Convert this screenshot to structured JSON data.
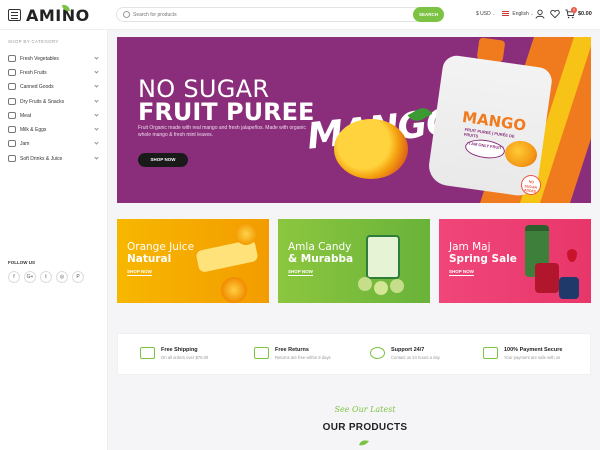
{
  "header": {
    "logo": "AMINO",
    "search_placeholder": "Search for products",
    "search_button": "SEARCH",
    "currency": "$ USD",
    "language": "English",
    "cart_total": "$0.00",
    "cart_count": "0"
  },
  "sidebar": {
    "title": "SHOP BY CATEGORY",
    "categories": [
      {
        "label": "Fresh Vegetables"
      },
      {
        "label": "Fresh Fruits"
      },
      {
        "label": "Canned Goods"
      },
      {
        "label": "Dry Fruits & Snacks"
      },
      {
        "label": "Meat"
      },
      {
        "label": "Milk & Eggs"
      },
      {
        "label": "Jam"
      },
      {
        "label": "Soft Drinks & Juice"
      }
    ],
    "follow_title": "FOLLOW US",
    "social": [
      "f",
      "G+",
      "t",
      "◎",
      "P"
    ]
  },
  "hero": {
    "line1": "NO SUGAR",
    "line2": "FRUIT PUREE",
    "description": "Fruit Organic made with real mango and fresh jalapeños. Made with organic whole mango & fresh mint leaves.",
    "button": "SHOP NOW",
    "brand_word": "MANGO",
    "pouch_label": "MANGO",
    "pouch_sub": "FRUIT PUREE | PURÉE DE FRUITS",
    "pouch_bubble": "\"I AM ONLY FRUIT\"",
    "badge": "NO SUGAR ADDED"
  },
  "promos": [
    {
      "title_light": "Orange Juice",
      "title_bold": "Natural",
      "link": "SHOP NOW",
      "color": "#f7b700"
    },
    {
      "title_light": "Amla Candy",
      "title_bold": "& Murabba",
      "link": "SHOP NOW",
      "color": "#8cc63f"
    },
    {
      "title_light": "Jam Maj",
      "title_bold": "Spring Sale",
      "link": "SHOP NOW",
      "color": "#f0467a"
    }
  ],
  "features": [
    {
      "title": "Free Shipping",
      "desc": "On all orders over $75.00"
    },
    {
      "title": "Free Returns",
      "desc": "Returns are free within 9 days"
    },
    {
      "title": "Support 24/7",
      "desc": "Contact us 24 hours a day"
    },
    {
      "title": "100% Payment Secure",
      "desc": "Your payment are safe with us"
    }
  ],
  "products_section": {
    "script_title": "See Our Latest",
    "title": "OUR PRODUCTS"
  },
  "colors": {
    "accent": "#7cc243",
    "hero_bg": "#8a2e7c",
    "orange": "#f07b1f"
  }
}
